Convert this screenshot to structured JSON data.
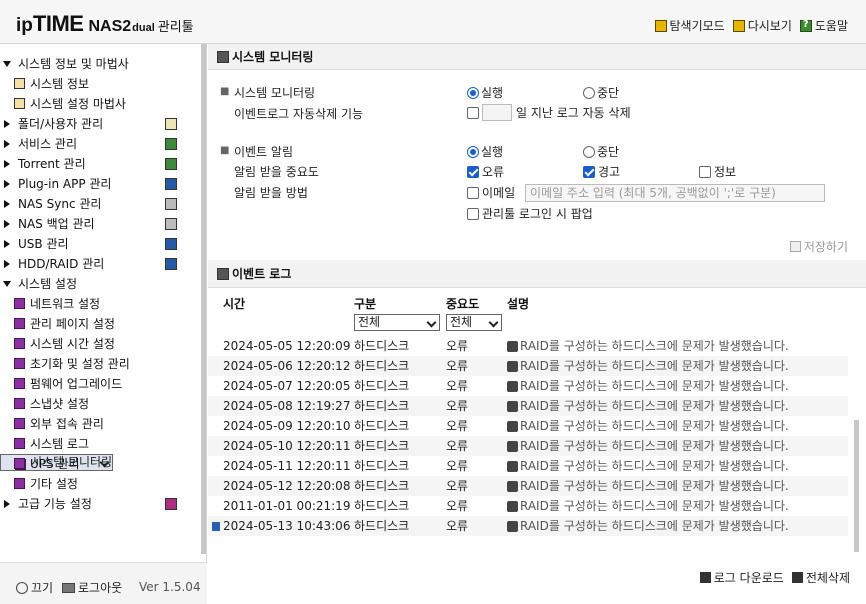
{
  "header": {
    "logo_ip": "ip",
    "logo_time": "TIME",
    "logo_nas": "NAS2",
    "logo_dual": "dual",
    "logo_admin": "관리툴",
    "links": [
      {
        "label": "탐색기모드",
        "icon": "folder-icon"
      },
      {
        "label": "다시보기",
        "icon": "refresh-icon"
      },
      {
        "label": "도움말",
        "icon": "help-icon"
      }
    ]
  },
  "sidebar": {
    "items": [
      {
        "label": "시스템 정보 및 마법사",
        "level": "top",
        "expanded": true
      },
      {
        "label": "시스템 정보",
        "level": "sub"
      },
      {
        "label": "시스템 설정 마법사",
        "level": "sub"
      },
      {
        "label": "폴더/사용자 관리",
        "level": "top"
      },
      {
        "label": "서비스 관리",
        "level": "top"
      },
      {
        "label": "Torrent 관리",
        "level": "top"
      },
      {
        "label": "Plug-in APP 관리",
        "level": "top"
      },
      {
        "label": "NAS Sync 관리",
        "level": "top"
      },
      {
        "label": "NAS 백업 관리",
        "level": "top"
      },
      {
        "label": "USB 관리",
        "level": "top"
      },
      {
        "label": "HDD/RAID 관리",
        "level": "top"
      },
      {
        "label": "시스템 설정",
        "level": "top",
        "expanded": true
      },
      {
        "label": "네트워크 설정",
        "level": "sub"
      },
      {
        "label": "관리 페이지 설정",
        "level": "sub"
      },
      {
        "label": "시스템 시간 설정",
        "level": "sub"
      },
      {
        "label": "초기화 및 설정 관리",
        "level": "sub"
      },
      {
        "label": "펌웨어 업그레이드",
        "level": "sub"
      },
      {
        "label": "스냅샷 설정",
        "level": "sub"
      },
      {
        "label": "외부 접속 관리",
        "level": "sub"
      },
      {
        "label": "시스템 로그",
        "level": "sub"
      },
      {
        "label": "시스템 모니터링",
        "level": "sub",
        "selected": true
      },
      {
        "label": "UPS 관리",
        "level": "sub"
      },
      {
        "label": "기타 설정",
        "level": "sub"
      },
      {
        "label": "고급 기능 설정",
        "level": "top"
      }
    ],
    "footer": {
      "power_label": "끄기",
      "logout_label": "로그아웃",
      "version": "Ver 1.5.04"
    }
  },
  "monitor": {
    "title": "시스템 모니터링",
    "monitor_label": "시스템 모니터링",
    "run_label": "실행",
    "stop_label": "중단",
    "autodelete_label": "이벤트로그 자동삭제 기능",
    "autodelete_suffix": "일 지난 로그 자동 삭제",
    "autodelete_days": "",
    "event_alert_label": "이벤트 알림",
    "alert_run_label": "실행",
    "alert_stop_label": "중단",
    "importance_label": "알림 받을 중요도",
    "importance_options": [
      "오류",
      "경고",
      "정보"
    ],
    "method_label": "알림 받을 방법",
    "email_label": "이메일",
    "email_placeholder": "이메일 주소 입력 (최대 5개, 공백없이 ';'로 구분)",
    "popup_label": "관리툴 로그인 시 팝업",
    "save_label": "저장하기"
  },
  "eventlog": {
    "title": "이벤트 로그",
    "columns": {
      "time": "시간",
      "category": "구분",
      "level": "중요도",
      "desc": "설명"
    },
    "category_filter": "전체",
    "level_filter": "전체",
    "rows": [
      {
        "time": "2024-05-05 12:20:09",
        "category": "하드디스크",
        "level": "오류",
        "desc": "RAID를 구성하는 하드디스크에 문제가 발생했습니다."
      },
      {
        "time": "2024-05-06 12:20:12",
        "category": "하드디스크",
        "level": "오류",
        "desc": "RAID를 구성하는 하드디스크에 문제가 발생했습니다."
      },
      {
        "time": "2024-05-07 12:20:05",
        "category": "하드디스크",
        "level": "오류",
        "desc": "RAID를 구성하는 하드디스크에 문제가 발생했습니다."
      },
      {
        "time": "2024-05-08 12:19:27",
        "category": "하드디스크",
        "level": "오류",
        "desc": "RAID를 구성하는 하드디스크에 문제가 발생했습니다."
      },
      {
        "time": "2024-05-09 12:20:10",
        "category": "하드디스크",
        "level": "오류",
        "desc": "RAID를 구성하는 하드디스크에 문제가 발생했습니다."
      },
      {
        "time": "2024-05-10 12:20:11",
        "category": "하드디스크",
        "level": "오류",
        "desc": "RAID를 구성하는 하드디스크에 문제가 발생했습니다."
      },
      {
        "time": "2024-05-11 12:20:11",
        "category": "하드디스크",
        "level": "오류",
        "desc": "RAID를 구성하는 하드디스크에 문제가 발생했습니다."
      },
      {
        "time": "2024-05-12 12:20:08",
        "category": "하드디스크",
        "level": "오류",
        "desc": "RAID를 구성하는 하드디스크에 문제가 발생했습니다."
      },
      {
        "time": "2011-01-01 00:21:19",
        "category": "하드디스크",
        "level": "오류",
        "desc": "RAID를 구성하는 하드디스크에 문제가 발생했습니다."
      },
      {
        "time": "2024-05-13 10:43:06",
        "category": "하드디스크",
        "level": "오류",
        "desc": "RAID를 구성하는 하드디스크에 문제가 발생했습니다.",
        "new": true
      }
    ],
    "download_label": "로그 다운로드",
    "delete_all_label": "전체삭제"
  }
}
